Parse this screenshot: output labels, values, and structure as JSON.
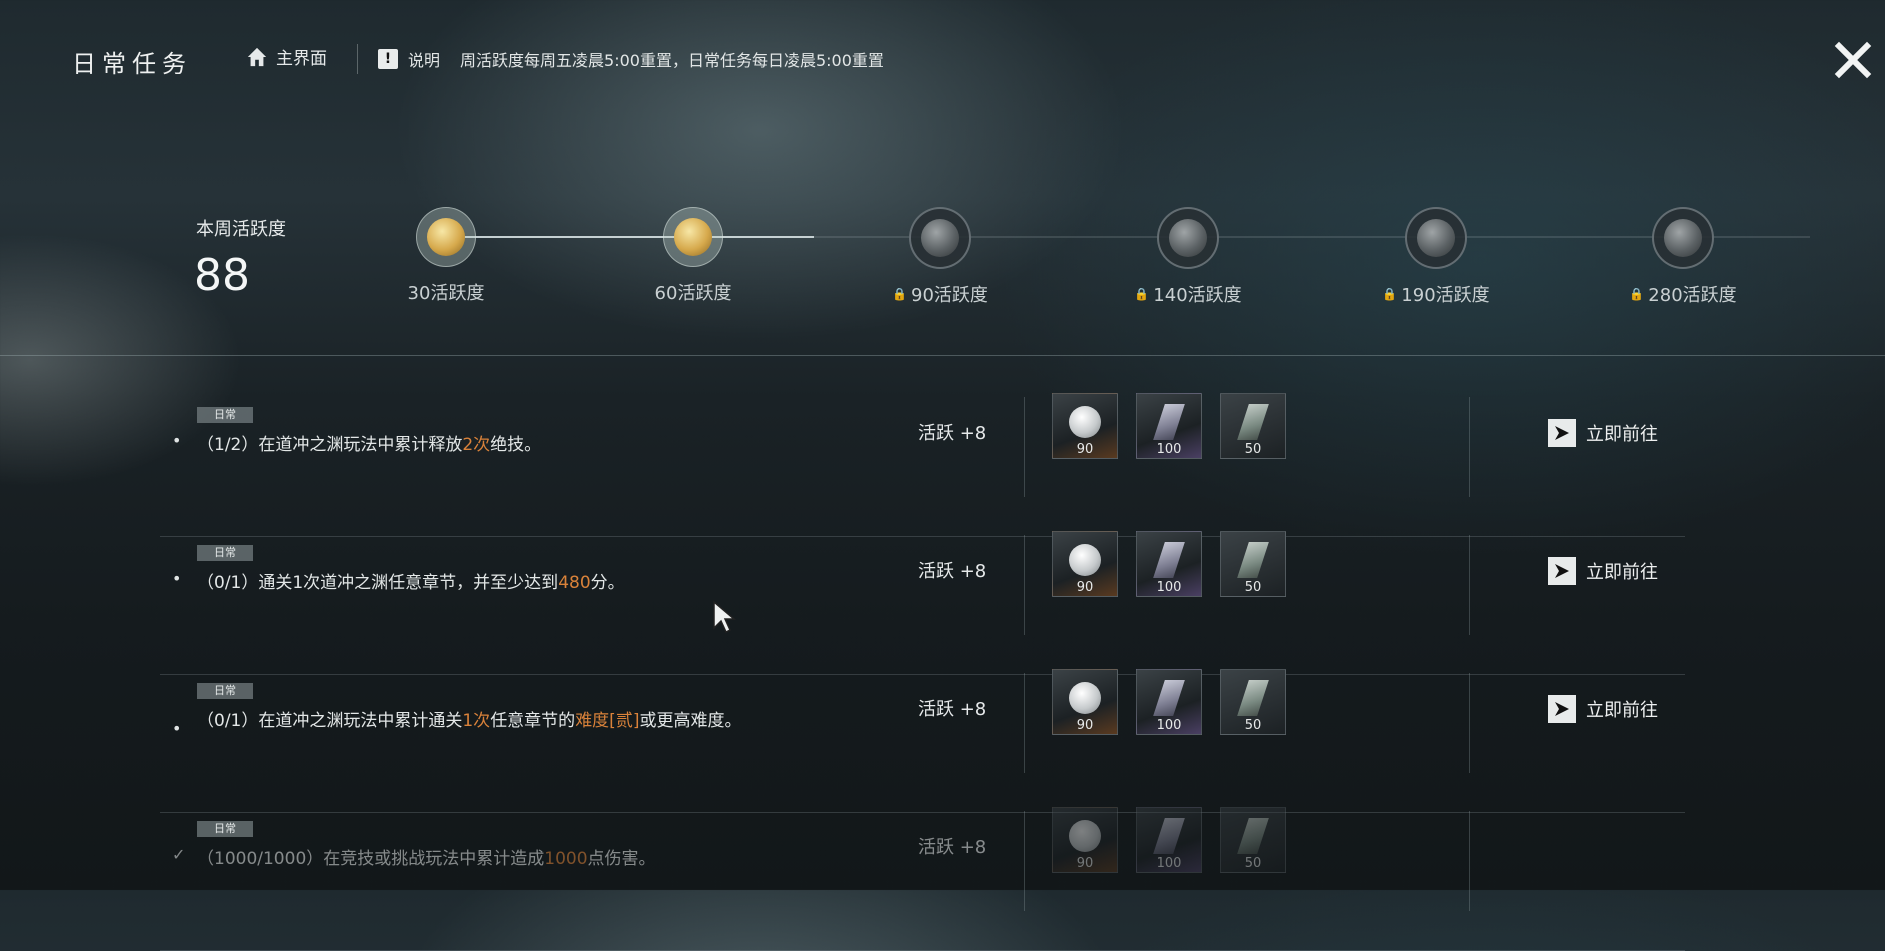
{
  "header": {
    "title": "日常任务",
    "home_label": "主界面",
    "note_label": "说明",
    "note_text": "周活跃度每周五凌晨5:00重置，日常任务每日凌晨5:00重置"
  },
  "weekly": {
    "label": "本周活跃度",
    "value": "88",
    "progress_fraction": 0.27,
    "milestones": [
      {
        "label": "30活跃度",
        "unlocked": true
      },
      {
        "label": "60活跃度",
        "unlocked": true
      },
      {
        "label": "90活跃度",
        "unlocked": false
      },
      {
        "label": "140活跃度",
        "unlocked": false
      },
      {
        "label": "190活跃度",
        "unlocked": false
      },
      {
        "label": "280活跃度",
        "unlocked": false
      }
    ]
  },
  "tasks": [
    {
      "tag": "日常",
      "progress": "（1/2）",
      "desc_a": "在道冲之渊玩法中累计释放",
      "desc_hl": "2次",
      "desc_b": "绝技。",
      "desc_hl2": "",
      "desc_c": "",
      "activity": "活跃 +8",
      "rewards": [
        "90",
        "100",
        "50"
      ],
      "go_label": "立即前往",
      "done": false
    },
    {
      "tag": "日常",
      "progress": "（0/1）",
      "desc_a": "通关1次道冲之渊任意章节，并至少达到",
      "desc_hl": "480",
      "desc_b": "分。",
      "desc_hl2": "",
      "desc_c": "",
      "activity": "活跃 +8",
      "rewards": [
        "90",
        "100",
        "50"
      ],
      "go_label": "立即前往",
      "done": false
    },
    {
      "tag": "日常",
      "progress": "（0/1）",
      "desc_a": "在道冲之渊玩法中累计通关",
      "desc_hl": "1次",
      "desc_b": "任意章节的",
      "desc_hl2": "难度[贰]",
      "desc_c": "或更高难度。",
      "activity": "活跃 +8",
      "rewards": [
        "90",
        "100",
        "50"
      ],
      "go_label": "立即前往",
      "done": false
    },
    {
      "tag": "日常",
      "progress": "（1000/1000）",
      "desc_a": "在竞技或挑战玩法中累计造成",
      "desc_hl": "1000",
      "desc_b": "点伤害。",
      "desc_hl2": "",
      "desc_c": "",
      "activity": "活跃 +8",
      "rewards": [
        "90",
        "100",
        "50"
      ],
      "go_label": "",
      "done": true
    }
  ],
  "colors": {
    "highlight": "#d9823a",
    "gold_coin": "#d6a94c"
  },
  "icons": {
    "home": "home-icon",
    "note": "exclamation-icon",
    "close": "close-icon",
    "go": "arrow-right-icon",
    "lock": "lock-icon",
    "done": "check-icon"
  }
}
